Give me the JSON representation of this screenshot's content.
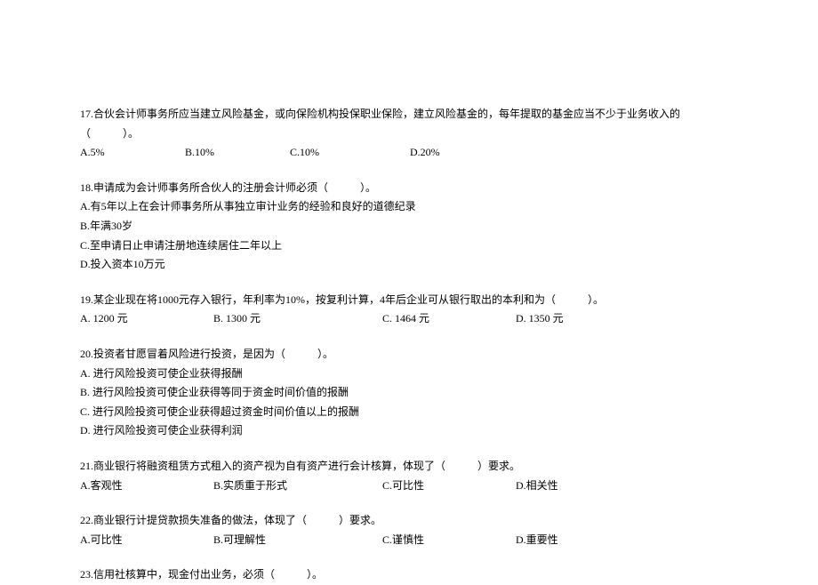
{
  "q17": {
    "text": "17.合伙会计师事务所应当建立风险基金，或向保险机构投保职业保险，建立风险基金的，每年提取的基金应当不少于业务收入的（　　　）。",
    "a": "A.5%",
    "b": "B.10%",
    "c": "C.10%",
    "d": "D.20%"
  },
  "q18": {
    "text": "18.申请成为会计师事务所合伙人的注册会计师必须（　　　）。",
    "a": "A.有5年以上在会计师事务所从事独立审计业务的经验和良好的道德纪录",
    "b": "B.年满30岁",
    "c": "C.至申请日止申请注册地连续居住二年以上",
    "d": "D.投入资本10万元"
  },
  "q19": {
    "text": "19.某企业现在将1000元存入银行，年利率为10%，按复利计算，4年后企业可从银行取出的本利和为（　　　）。",
    "a": "A. 1200 元",
    "b": "B. 1300 元",
    "c": "C. 1464 元",
    "d": "D. 1350 元"
  },
  "q20": {
    "text": "20.投资者甘愿冒着风险进行投资，是因为（　　　）。",
    "a": "A. 进行风险投资可使企业获得报酬",
    "b": "B. 进行风险投资可使企业获得等同于资金时间价值的报酬",
    "c": "C. 进行风险投资可使企业获得超过资金时间价值以上的报酬",
    "d": "D. 进行风险投资可使企业获得利润"
  },
  "q21": {
    "text": "21.商业银行将融资租赁方式租入的资产视为自有资产进行会计核算，体现了（　　　）要求。",
    "a": "A.客观性",
    "b": "B.实质重于形式",
    "c": "C.可比性",
    "d": "D.相关性"
  },
  "q22": {
    "text": "22.商业银行计提贷款损失准备的做法，体现了（　　　）要求。",
    "a": "A.可比性",
    "b": "B.可理解性",
    "c": "C.谨慎性",
    "d": "D.重要性"
  },
  "q23": {
    "text": "23.信用社核算中，现金付出业务，必须（　　　）。"
  }
}
